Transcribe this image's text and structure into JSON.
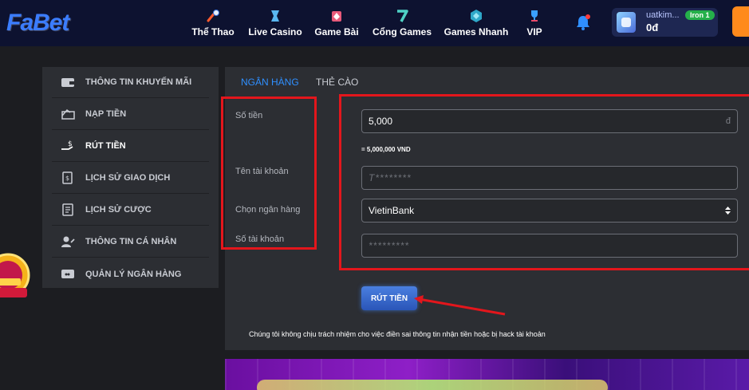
{
  "header": {
    "logo": "FaBet",
    "nav": [
      {
        "label": "Thể Thao",
        "icon": "sports-icon"
      },
      {
        "label": "Live Casino",
        "icon": "casino-icon"
      },
      {
        "label": "Game Bài",
        "icon": "cards-icon"
      },
      {
        "label": "Cổng Games",
        "icon": "games-icon"
      },
      {
        "label": "Games Nhanh",
        "icon": "fast-games-icon"
      },
      {
        "label": "VIP",
        "icon": "trophy-icon"
      }
    ],
    "user": {
      "name": "uatkim...",
      "balance": "0đ",
      "rank": "Iron 1"
    }
  },
  "sidebar": {
    "items": [
      {
        "label": "THÔNG TIN KHUYẾN MÃI",
        "icon": "wallet-icon"
      },
      {
        "label": "NẠP TIỀN",
        "icon": "deposit-icon"
      },
      {
        "label": "RÚT TIỀN",
        "icon": "withdraw-icon",
        "active": true
      },
      {
        "label": "LỊCH SỬ GIAO DỊCH",
        "icon": "transaction-history-icon"
      },
      {
        "label": "LỊCH SỬ CƯỢC",
        "icon": "bet-history-icon"
      },
      {
        "label": "THÔNG TIN CÁ NHÂN",
        "icon": "profile-icon"
      },
      {
        "label": "QUẢN LÝ NGÂN HÀNG",
        "icon": "bank-card-icon"
      }
    ]
  },
  "main": {
    "tabs": [
      {
        "label": "NGÂN HÀNG",
        "active": true
      },
      {
        "label": "THẺ CÀO",
        "active": false
      }
    ],
    "form": {
      "amount_label": "Số tiền",
      "amount_value": "5,000",
      "amount_suffix": "đ",
      "conversion": "= 5,000,000 VND",
      "account_name_label": "Tên tài khoản",
      "account_name_placeholder": "T********",
      "bank_label": "Chọn ngân hàng",
      "bank_value": "VietinBank",
      "account_number_label": "Số tài khoản",
      "account_number_placeholder": "*********"
    },
    "submit_label": "RÚT TIỀN",
    "disclaimer": "Chúng tôi không chịu trách nhiệm cho việc điền sai thông tin nhận tiền hoặc bị hack tài khoản"
  },
  "colors": {
    "header_bg": "#0d1230",
    "accent_blue": "#2f8fff",
    "annotation_red": "#e3161c",
    "panel_bg": "#2c2e33"
  }
}
